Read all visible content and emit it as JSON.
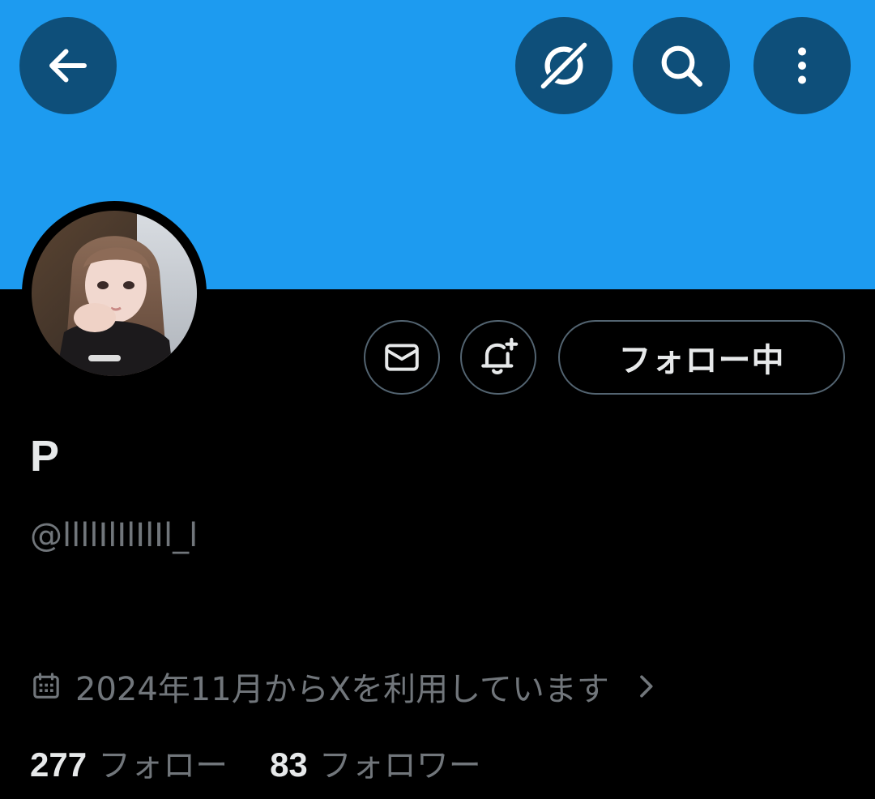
{
  "header": {
    "back_icon": "arrow-left-icon",
    "grok_icon": "grok-icon",
    "search_icon": "search-icon",
    "more_icon": "more-vertical-icon",
    "banner_color": "#1d9bf0",
    "button_color": "#0e4f7a"
  },
  "profile": {
    "display_name": "P",
    "handle": "@llllIlIlIlIl_l",
    "joined": "2024年11月からXを利用しています",
    "avatar_icon": "profile-photo"
  },
  "actions": {
    "message_icon": "mail-icon",
    "notify_icon": "bell-plus-icon",
    "follow_label": "フォロー中"
  },
  "stats": {
    "following_count": "277",
    "following_label": "フォロー",
    "followers_count": "83",
    "followers_label": "フォロワー"
  },
  "colors": {
    "background": "#000000",
    "primary_text": "#e7e9ea",
    "secondary_text": "#71767b",
    "border": "#536471"
  }
}
